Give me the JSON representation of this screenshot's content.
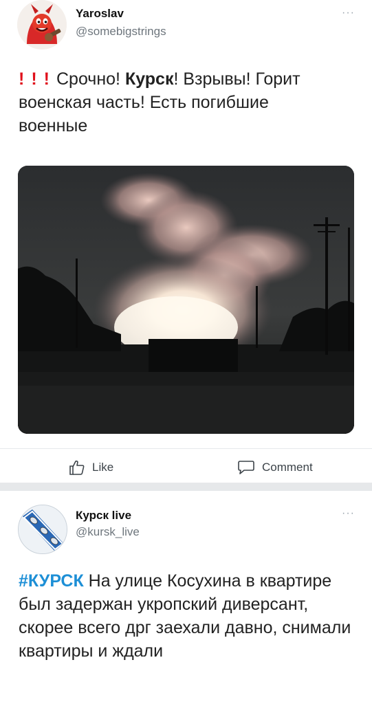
{
  "post1": {
    "author_name": "Yaroslav",
    "author_handle": "@somebigstrings",
    "more_label": "···",
    "text": {
      "bangs": [
        "!",
        "!",
        "!"
      ],
      "part1": "Срочно! ",
      "bold": "Курск",
      "part2": "! Взрывы! Горит военская часть! Есть погибшие военные"
    }
  },
  "actions": {
    "like_label": "Like",
    "comment_label": "Comment"
  },
  "post2": {
    "author_name": "Курск live",
    "author_handle": "@kursk_live",
    "more_label": "···",
    "text": {
      "hashtag": "#КУРСК",
      "body": " На улице Косухина в квартире был задержан укропский диверсант, скорее всего дрг заехали давно, снимали квартиры и ждали"
    }
  },
  "colors": {
    "link": "#1d8fd6",
    "emphasis_red": "#e0101b"
  }
}
